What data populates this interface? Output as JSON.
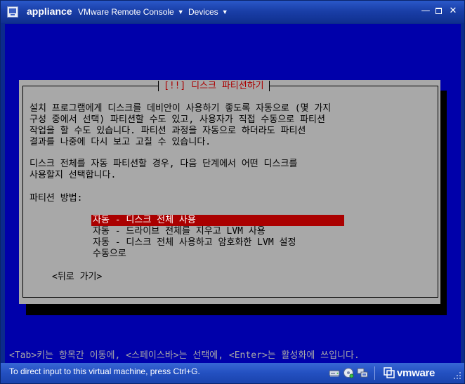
{
  "window": {
    "app_name": "appliance",
    "menu_console": "VMware Remote Console",
    "menu_devices": "Devices",
    "minimize_glyph": "—",
    "close_glyph": "✕"
  },
  "installer": {
    "dialog_title": "[!!] 디스크 파티션하기",
    "intro_text": "설치 프로그램에게 디스크를 데비안이 사용하기 좋도록 자동으로 (몇 가지\n구성 중에서 선택) 파티션할 수도 있고, 사용자가 직접 수동으로 파티션\n작업을 할 수도 있습니다. 파티션 과정을 자동으로 하더라도 파티션\n결과를 나중에 다시 보고 고칠 수 있습니다.",
    "whole_disk_text": "디스크 전체를 자동 파티션할 경우, 다음 단계에서 어떤 디스크를\n사용할지 선택합니다.",
    "method_label": "파티션 방법:",
    "options": [
      {
        "label": "자동 - 디스크 전체 사용",
        "selected": true
      },
      {
        "label": "자동 - 드라이브 전체를 지우고 LVM 사용",
        "selected": false
      },
      {
        "label": "자동 - 디스크 전체 사용하고 암호화한 LVM 설정",
        "selected": false
      },
      {
        "label": "수동으로",
        "selected": false
      }
    ],
    "back_button": "<뒤로 가기>",
    "help_line": "<Tab>키는 항목간 이동에, <스페이스바>는 선택에, <Enter>는 활성화에 쓰입니다."
  },
  "statusbar": {
    "message": "To direct input to this virtual machine, press Ctrl+G.",
    "logo_text": "vmware",
    "icons": [
      "hard-disk-icon",
      "cd-rom-icon",
      "network-adapter-icon"
    ]
  },
  "colors": {
    "console_background": "#0000aa",
    "dialog_background": "#a8a8a8",
    "dialog_title": "#aa0000",
    "selection": "#aa0000",
    "titlebar": "#1a3fa8"
  }
}
